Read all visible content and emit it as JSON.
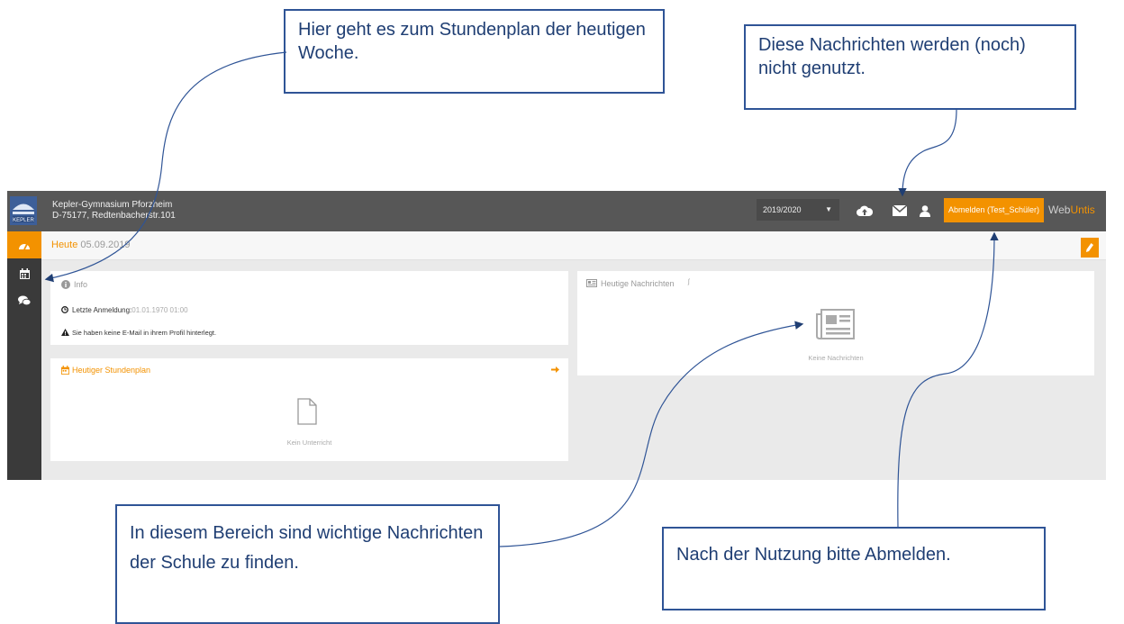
{
  "header": {
    "school_name": "Kepler-Gymnasium Pforzheim",
    "school_address": "D-75177, Redtenbacherstr.101",
    "school_year": "2019/2020",
    "logout_label": "Abmelden (Test_Schüler)",
    "brand_web": "Web",
    "brand_untis": "Untis"
  },
  "subheader": {
    "today_label": "Heute",
    "today_date": "05.09.2019"
  },
  "info_card": {
    "title": "Info",
    "last_login_label": "Letzte Anmeldung:",
    "last_login_value": "01.01.1970 01:00",
    "warning_text": "Sie haben keine E-Mail in ihrem Profil hinterlegt."
  },
  "timetable_card": {
    "title": "Heutiger Stundenplan",
    "empty_text": "Kein Unterricht"
  },
  "news_card": {
    "title": "Heutige Nachrichten",
    "empty_text": "Keine Nachrichten"
  },
  "callouts": {
    "timetable": "Hier geht es zum Stundenplan der heutigen Woche.",
    "messages": "Diese Nachrichten werden (noch) nicht genutzt.",
    "news": "In diesem Bereich sind wichtige Nachrichten der Schule zu finden.",
    "logout": "Nach der Nutzung bitte Abmelden."
  },
  "colors": {
    "accent": "#f39200",
    "topbar": "#575757",
    "sidebar": "#3a3a3a",
    "callout_border": "#2f5496"
  },
  "icons": [
    "school-logo-icon",
    "dashboard-icon",
    "calendar-icon",
    "chat-icon",
    "upload-cloud-icon",
    "envelope-icon",
    "user-icon",
    "pencil-icon",
    "info-icon",
    "clock-icon",
    "warning-icon",
    "arrow-right-icon",
    "document-icon",
    "newspaper-icon",
    "rss-icon"
  ]
}
